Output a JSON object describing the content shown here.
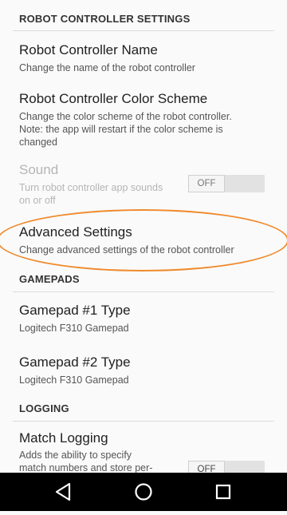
{
  "sections": {
    "robot_controller_settings": "ROBOT CONTROLLER SETTINGS",
    "gamepads": "GAMEPADS",
    "logging": "LOGGING"
  },
  "prefs": {
    "name": {
      "title": "Robot Controller Name",
      "summary": "Change the name of the robot controller"
    },
    "color_scheme": {
      "title": "Robot Controller Color Scheme",
      "summary_line1": "Change the color scheme of the robot controller.",
      "summary_line2": "Note: the app will restart if the color scheme is",
      "summary_line3": "changed"
    },
    "sound": {
      "title": "Sound",
      "summary_line1": "Turn robot controller app sounds",
      "summary_line2": "on or off",
      "toggle_label": "OFF",
      "enabled": false
    },
    "advanced": {
      "title": "Advanced Settings",
      "summary": "Change advanced settings of the robot controller"
    },
    "gamepad1": {
      "title": "Gamepad #1 Type",
      "summary": "Logitech F310 Gamepad"
    },
    "gamepad2": {
      "title": "Gamepad #2 Type",
      "summary": "Logitech F310 Gamepad"
    },
    "match_logging": {
      "title": "Match Logging",
      "summary_line1": "Adds the ability to specify",
      "summary_line2": "match numbers and store per-",
      "toggle_label": "OFF"
    }
  },
  "nav": {
    "back": "back-icon",
    "home": "home-icon",
    "recents": "recents-icon"
  },
  "colors": {
    "highlight": "#f08a2c",
    "navbar": "#000000"
  }
}
